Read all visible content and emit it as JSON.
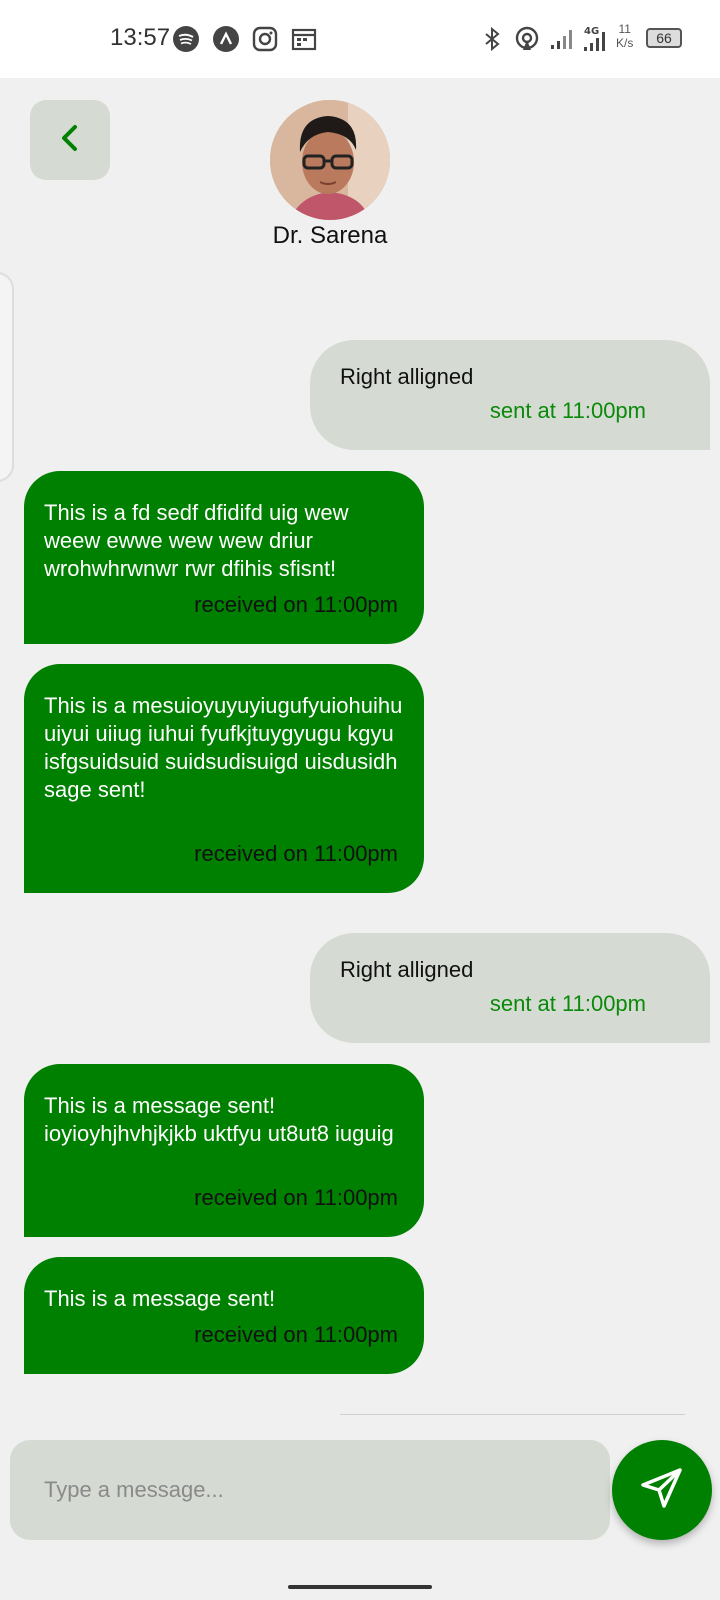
{
  "status_bar": {
    "time": "13:57",
    "network_type": "4G",
    "speed_value": "11",
    "speed_unit": "K/s",
    "battery": "66",
    "icons": [
      "spotify-icon",
      "app-icon",
      "instagram-icon",
      "calendar-icon",
      "bluetooth-icon",
      "hotspot-icon",
      "signal-icon",
      "signal-4g-icon"
    ]
  },
  "header": {
    "contact_name": "Dr. Sarena"
  },
  "messages": [
    {
      "type": "sent",
      "text": "Right alligned",
      "meta": "sent at 11:00pm"
    },
    {
      "type": "received",
      "text": "This is a fd sedf dfidifd   uig wew weew ewwe wew wew driur wrohwhrwnwr rwr dfihis sfisnt!",
      "meta": "received on 11:00pm"
    },
    {
      "type": "received",
      "text": "This is a mesuioyuyuyiugufyuiohuihu uiyui uiiug iuhui fyufkjtuygyugu kgyu isfgsuidsuid suidsudisuigd uisdusidh sage sent!",
      "meta": "received on 11:00pm"
    },
    {
      "type": "sent",
      "text": "Right alligned",
      "meta": "sent at 11:00pm"
    },
    {
      "type": "received",
      "text": "This is a message sent! ioyioyhjhvhjkjkb uktfyu ut8ut8 iuguig",
      "meta": "received on 11:00pm"
    },
    {
      "type": "received",
      "text": "This is a message sent!",
      "meta": "received on 11:00pm"
    }
  ],
  "composer": {
    "placeholder": "Type a message..."
  },
  "colors": {
    "accent": "#008000",
    "bubble_sent": "#d5dbd3",
    "background": "#f0f0f0"
  }
}
